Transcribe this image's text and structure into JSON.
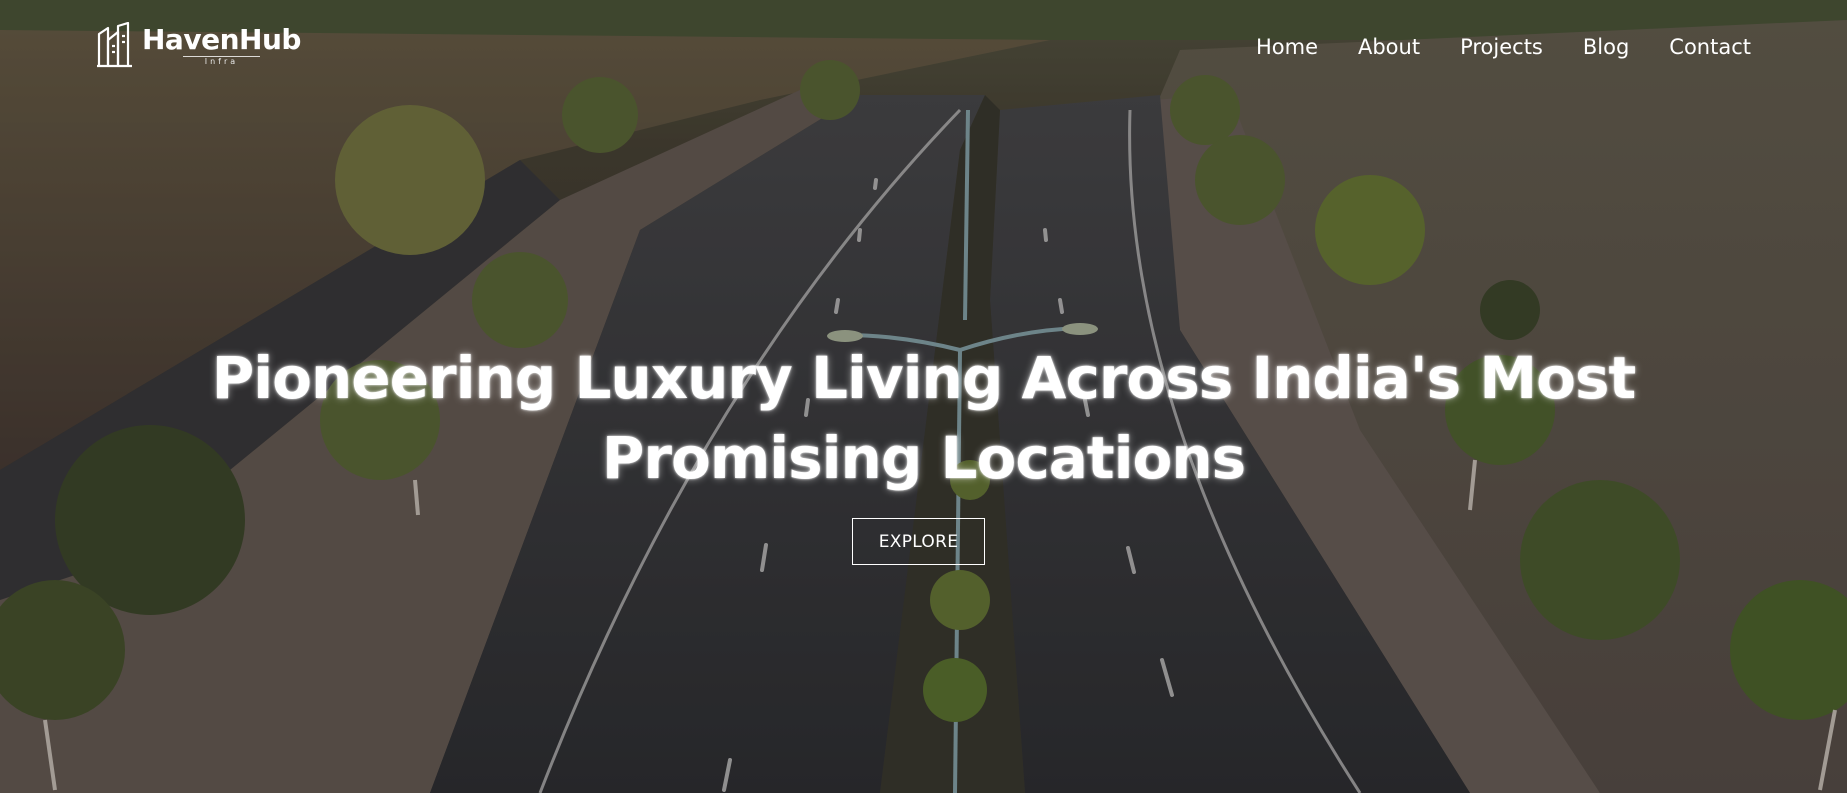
{
  "brand": {
    "name": "HavenHub",
    "tagline": "Infra"
  },
  "nav": {
    "items": [
      {
        "label": "Home"
      },
      {
        "label": "About"
      },
      {
        "label": "Projects"
      },
      {
        "label": "Blog"
      },
      {
        "label": "Contact"
      }
    ]
  },
  "hero": {
    "headline_line1": "Pioneering Luxury Living Across India's Most",
    "headline_line2": "Promising Locations",
    "cta_label": "EXPLORE"
  },
  "colors": {
    "text": "#ffffff",
    "overlay": "#141212",
    "road": "#333538",
    "greenery": "#6b7a3a",
    "sidewalk": "#6e625c",
    "soil": "#7a6a55"
  },
  "icons": {
    "logo": "building-outline-icon"
  }
}
